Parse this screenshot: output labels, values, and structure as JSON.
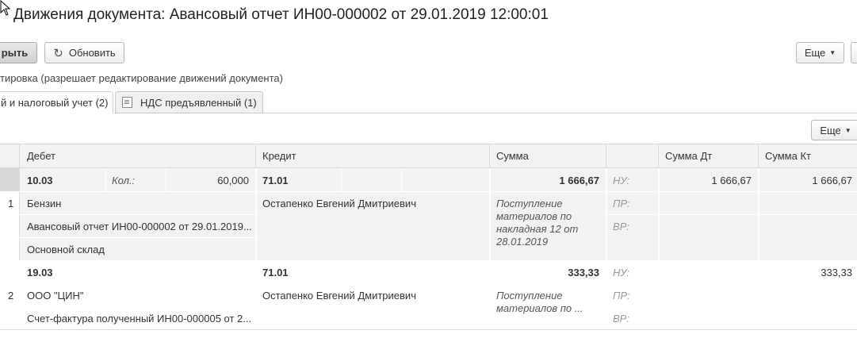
{
  "window": {
    "title": "Движения документа: Авансовый отчет ИН00-000002 от 29.01.2019 12:00:01"
  },
  "toolbar": {
    "close_label": "рыть",
    "refresh_label": "Обновить",
    "more_label": "Еще"
  },
  "hint_text": "тировка (разрешает редактирование движений документа)",
  "tabs": [
    {
      "label": "й и налоговый учет (2)",
      "active": true
    },
    {
      "label": "НДС предъявленный (1)",
      "active": false
    }
  ],
  "table": {
    "more_label": "Еще",
    "columns": [
      "Дебет",
      "Кредит",
      "Сумма",
      "",
      "Сумма Дт",
      "Сумма Кт"
    ],
    "rows": [
      {
        "num": "1",
        "debit_account": "10.03",
        "qty_label": "Кол.:",
        "qty_value": "60,000",
        "credit_account": "71.01",
        "amount": "1 666,67",
        "nu_label": "НУ:",
        "sum_dt": "1 666,67",
        "sum_kt": "1 666,67",
        "debit_sub1": "Бензин",
        "debit_sub2": "Авансовый отчет ИН00-000002 от 29.01.2019...",
        "debit_sub3": "Основной склад",
        "credit_sub1": "Остапенко Евгений Дмитриевич",
        "content_lines": [
          "Поступление",
          "материалов по",
          "накладная 12 от",
          "28.01.2019"
        ],
        "pr_label": "ПР:",
        "vr_label": "ВР:"
      },
      {
        "num": "2",
        "debit_account": "19.03",
        "credit_account": "71.01",
        "amount": "333,33",
        "nu_label": "НУ:",
        "sum_kt": "333,33",
        "debit_sub1": "ООО \"ЦИН\"",
        "debit_sub2": "Счет-фактура полученный ИН00-000005 от 2...",
        "credit_sub1": "Остапенко Евгений Дмитриевич",
        "content_lines": [
          "Поступление",
          "материалов по ..."
        ],
        "pr_label": "ПР:",
        "vr_label": "ВР:"
      }
    ]
  }
}
